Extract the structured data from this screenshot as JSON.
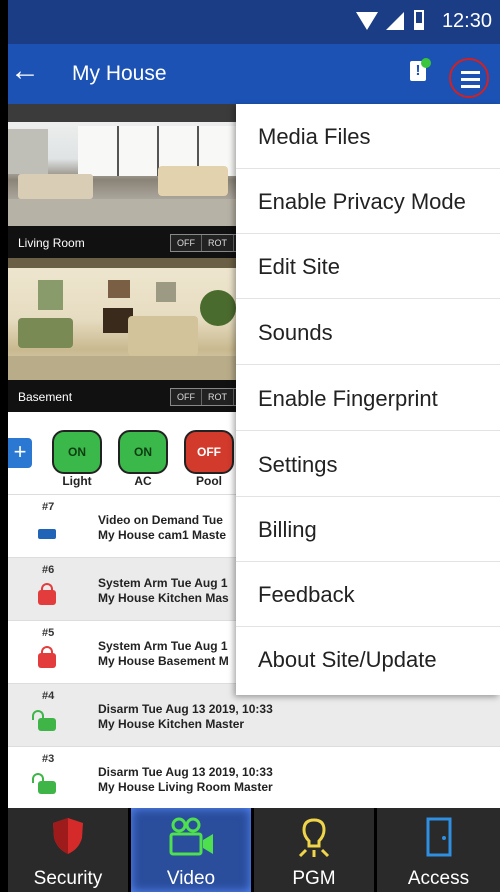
{
  "status_bar": {
    "time": "12:30"
  },
  "app_bar": {
    "back_icon": "arrow-left-icon",
    "title": "My House"
  },
  "cameras": [
    {
      "name": "Living Room",
      "toggle_off": "OFF",
      "toggle_rot": "ROT"
    },
    {
      "name": "Basement",
      "toggle_off": "OFF",
      "toggle_rot": "ROT"
    }
  ],
  "controls": [
    {
      "label": "Light",
      "state": "ON"
    },
    {
      "label": "AC",
      "state": "ON"
    },
    {
      "label": "Pool",
      "state": "OFF"
    }
  ],
  "events": [
    {
      "num": "#7",
      "line1": "Video on Demand Tue",
      "line2": "My House cam1 Maste",
      "icon": "video-camera-icon"
    },
    {
      "num": "#6",
      "line1": "System Arm Tue Aug 1",
      "line2": "My House Kitchen Mas",
      "icon": "locked-padlock-icon"
    },
    {
      "num": "#5",
      "line1": "System Arm Tue Aug 1",
      "line2": "My House Basement M",
      "icon": "locked-padlock-icon"
    },
    {
      "num": "#4",
      "line1": "Disarm Tue Aug 13 2019, 10:33",
      "line2": "My House Kitchen Master",
      "icon": "unlocked-padlock-icon"
    },
    {
      "num": "#3",
      "line1": "Disarm Tue Aug 13 2019, 10:33",
      "line2": "My House Living Room Master",
      "icon": "unlocked-padlock-icon"
    }
  ],
  "menu": {
    "items": [
      "Media Files",
      "Enable Privacy Mode",
      "Edit Site",
      "Sounds",
      "Enable Fingerprint",
      "Settings",
      "Billing",
      "Feedback",
      "About Site/Update"
    ]
  },
  "bottom_nav": [
    {
      "label": "Security",
      "icon": "shield-icon"
    },
    {
      "label": "Video",
      "icon": "video-camera-icon",
      "active": true
    },
    {
      "label": "PGM",
      "icon": "light-bulb-icon"
    },
    {
      "label": "Access",
      "icon": "door-icon"
    }
  ],
  "colors": {
    "app_bar": "#1c52b4",
    "status_bar": "#1b3d86",
    "on_green": "#3bb84a",
    "off_red": "#d23a2c",
    "highlight_circle": "#d42020"
  }
}
